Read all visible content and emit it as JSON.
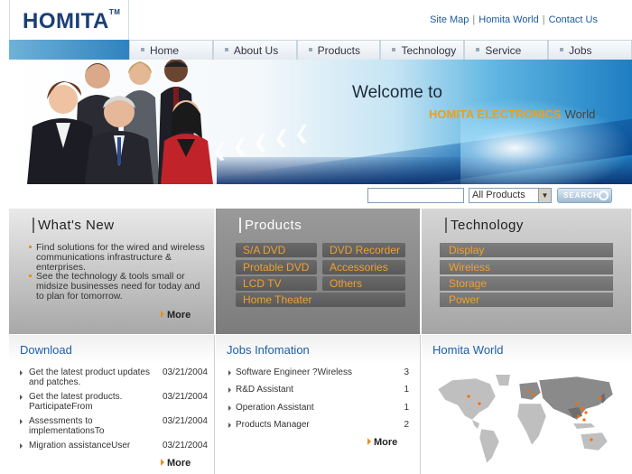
{
  "header": {
    "logo_text": "HOMITA",
    "logo_tm": "TM",
    "links": [
      "Site Map",
      "Homita World",
      "Contact Us"
    ],
    "separator": "|"
  },
  "nav": {
    "tabs": [
      "Home",
      "About Us",
      "Products",
      "Technology",
      "Service",
      "Jobs"
    ]
  },
  "banner": {
    "welcome": "Welcome to",
    "brand": "HOMITA ELECTRONICS",
    "world": "World"
  },
  "search": {
    "input_value": "",
    "select_value": "All Products",
    "button_label": "SEARCH"
  },
  "whats_new": {
    "title": "What's New",
    "items": [
      "Find solutions for the wired and wireless communications infrastructure & enterprises.",
      "See the technology & tools small or midsize businesses need for today and to plan for tomorrow."
    ],
    "more": "More"
  },
  "products": {
    "title": "Products",
    "items": [
      "S/A DVD",
      "DVD Recorder",
      "Protable DVD",
      "Accessories",
      "LCD TV",
      "Others",
      "Home Theater"
    ]
  },
  "technology": {
    "title": "Technology",
    "items": [
      "Display",
      "Wireless",
      "Storage",
      "Power"
    ]
  },
  "download": {
    "title": "Download",
    "rows": [
      {
        "text": "Get the latest product updates and patches.",
        "date": "03/21/2004"
      },
      {
        "text": "Get the latest products. ParticipateFrom",
        "date": "03/21/2004"
      },
      {
        "text": "Assessments to implementationsTo",
        "date": "03/21/2004"
      },
      {
        "text": "Migration assistanceUser",
        "date": "03/21/2004"
      }
    ],
    "more": "More"
  },
  "jobs": {
    "title": "Jobs Infomation",
    "rows": [
      {
        "text": "Software Engineer ?Wireless",
        "count": "3"
      },
      {
        "text": "R&D Assistant",
        "count": "1"
      },
      {
        "text": "Operation Assistant",
        "count": "1"
      },
      {
        "text": "Products Manager",
        "count": "2"
      }
    ],
    "more": "More"
  },
  "world": {
    "title": "Homita World"
  },
  "colors": {
    "brand_blue": "#1a3e78",
    "link_blue": "#1c5aa3",
    "accent_orange": "#e8a020"
  }
}
